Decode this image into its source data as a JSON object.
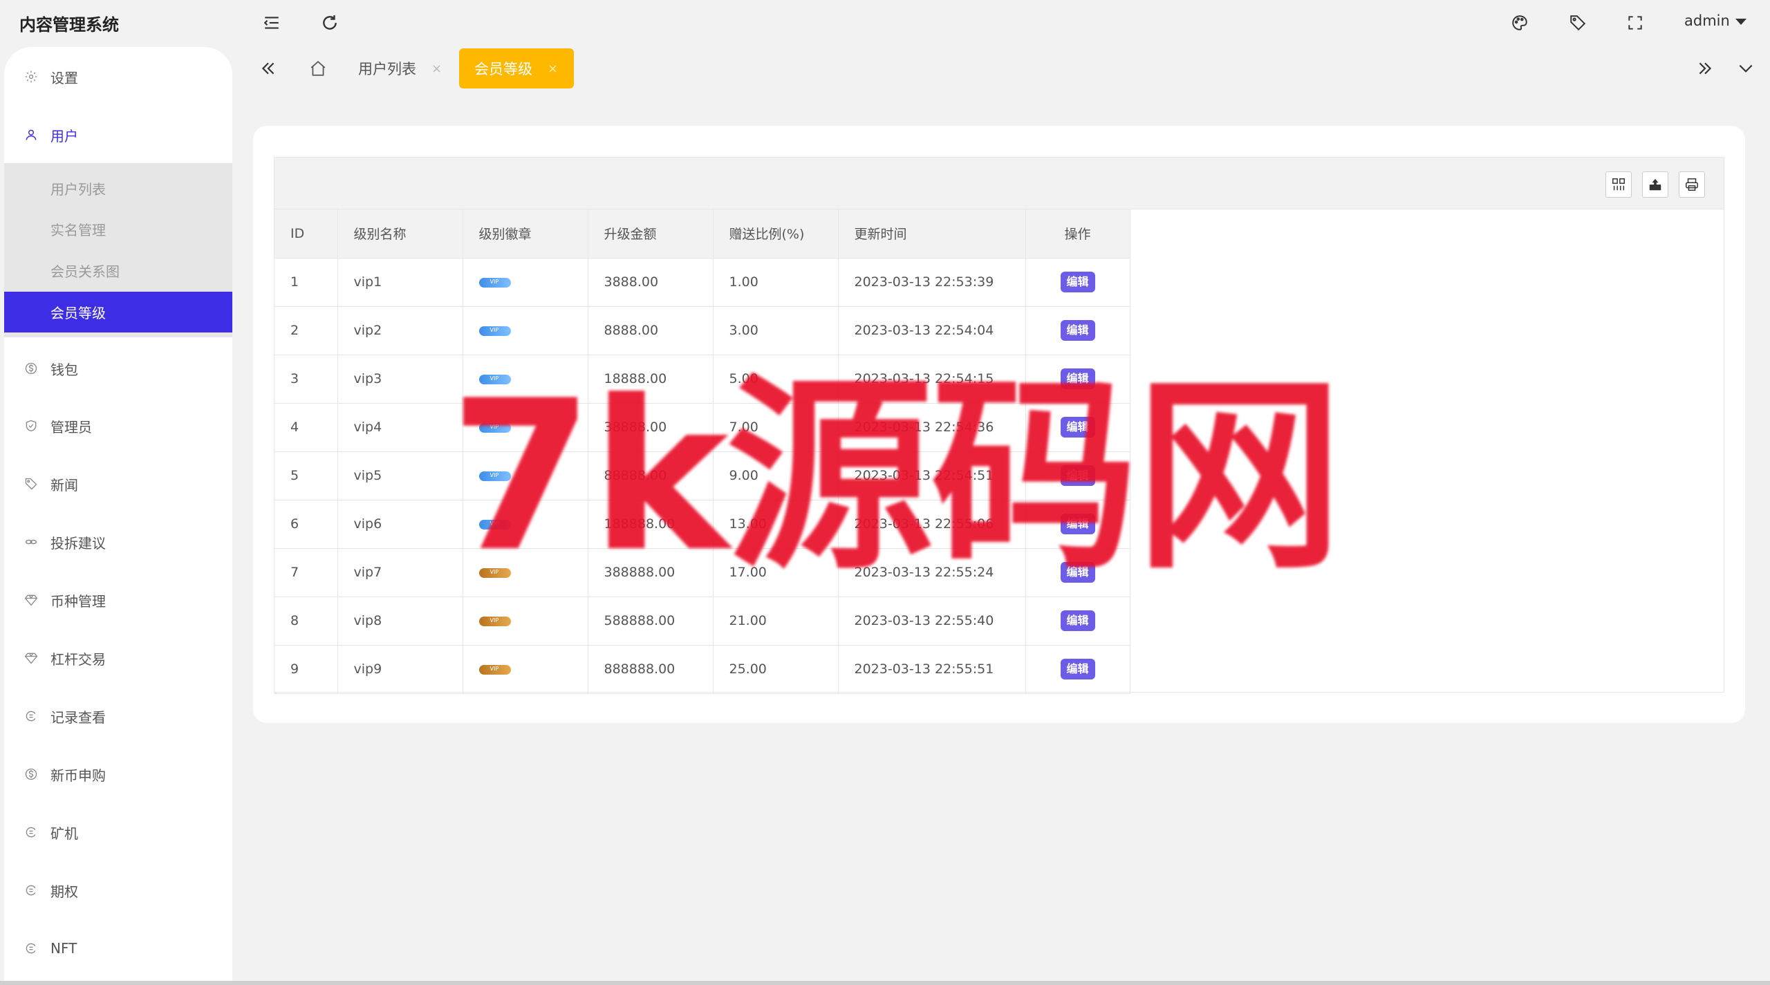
{
  "app": {
    "title": "内容管理系统",
    "user": "admin"
  },
  "header": {
    "icons": [
      "menu-fold-icon",
      "refresh-icon",
      "palette-icon",
      "tag-icon",
      "fullscreen-icon"
    ]
  },
  "sidebar": {
    "items": [
      {
        "label": "设置",
        "icon": "gear-icon"
      },
      {
        "label": "用户",
        "icon": "user-icon"
      },
      {
        "label": "钱包",
        "icon": "dollar-icon"
      },
      {
        "label": "管理员",
        "icon": "shield-icon"
      },
      {
        "label": "新闻",
        "icon": "tag-icon"
      },
      {
        "label": "投拆建议",
        "icon": "link-icon"
      },
      {
        "label": "币种管理",
        "icon": "diamond-icon"
      },
      {
        "label": "杠杆交易",
        "icon": "diamond-icon"
      },
      {
        "label": "记录查看",
        "icon": "cycle-icon"
      },
      {
        "label": "新币申购",
        "icon": "dollar-icon"
      },
      {
        "label": "矿机",
        "icon": "cycle-icon"
      },
      {
        "label": "期权",
        "icon": "cycle-icon"
      },
      {
        "label": "NFT",
        "icon": "cycle-icon"
      }
    ],
    "submenu": [
      {
        "label": "用户列表"
      },
      {
        "label": "实名管理"
      },
      {
        "label": "会员关系图"
      },
      {
        "label": "会员等级"
      }
    ]
  },
  "tabs": [
    {
      "label": "用户列表",
      "close": "×"
    },
    {
      "label": "会员等级",
      "close": "×"
    }
  ],
  "table": {
    "columns": [
      "ID",
      "级别名称",
      "级别徽章",
      "升级金额",
      "赠送比例(%)",
      "更新时间",
      "操作"
    ],
    "edit_label": "编辑",
    "badge_text": "VIP",
    "rows": [
      {
        "id": "1",
        "name": "vip1",
        "badge": "blue",
        "amount": "3888.00",
        "ratio": "1.00",
        "time": "2023-03-13 22:53:39"
      },
      {
        "id": "2",
        "name": "vip2",
        "badge": "blue",
        "amount": "8888.00",
        "ratio": "3.00",
        "time": "2023-03-13 22:54:04"
      },
      {
        "id": "3",
        "name": "vip3",
        "badge": "blue",
        "amount": "18888.00",
        "ratio": "5.00",
        "time": "2023-03-13 22:54:15"
      },
      {
        "id": "4",
        "name": "vip4",
        "badge": "blue",
        "amount": "38888.00",
        "ratio": "7.00",
        "time": "2023-03-13 22:54:36"
      },
      {
        "id": "5",
        "name": "vip5",
        "badge": "blue",
        "amount": "88888.00",
        "ratio": "9.00",
        "time": "2023-03-13 22:54:51"
      },
      {
        "id": "6",
        "name": "vip6",
        "badge": "blue",
        "amount": "188888.00",
        "ratio": "13.00",
        "time": "2023-03-13 22:55:06"
      },
      {
        "id": "7",
        "name": "vip7",
        "badge": "gold",
        "amount": "388888.00",
        "ratio": "17.00",
        "time": "2023-03-13 22:55:24"
      },
      {
        "id": "8",
        "name": "vip8",
        "badge": "gold",
        "amount": "588888.00",
        "ratio": "21.00",
        "time": "2023-03-13 22:55:40"
      },
      {
        "id": "9",
        "name": "vip9",
        "badge": "gold",
        "amount": "888888.00",
        "ratio": "25.00",
        "time": "2023-03-13 22:55:51"
      }
    ]
  },
  "toolbar_icons": [
    "columns-icon",
    "export-icon",
    "print-icon"
  ],
  "watermark": "7k源码网",
  "colors": {
    "accent": "#3d2ee6",
    "active_tab": "#ffb800",
    "edit_button": "#6c5ce7",
    "watermark": "#e8102a"
  }
}
